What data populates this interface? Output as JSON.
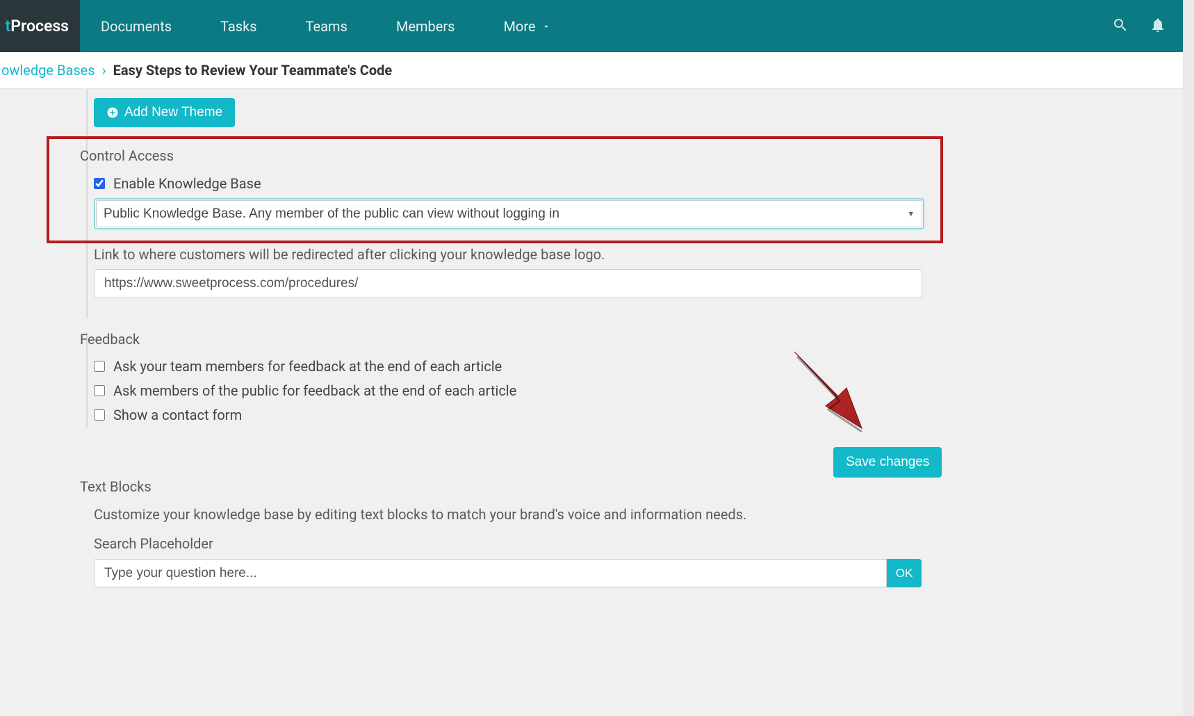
{
  "logo": {
    "t": "t",
    "process": "Process"
  },
  "nav": {
    "documents": "Documents",
    "tasks": "Tasks",
    "teams": "Teams",
    "members": "Members",
    "more": "More"
  },
  "breadcrumb": {
    "link": "owledge Bases",
    "sep": "›",
    "current": "Easy Steps to Review Your Teammate's Code"
  },
  "add_theme_btn": "Add New Theme",
  "control_access": {
    "heading": "Control Access",
    "enable_label": "Enable Knowledge Base",
    "select_value": "Public Knowledge Base. Any member of the public can view without logging in",
    "redirect_label": "Link to where customers will be redirected after clicking your knowledge base logo.",
    "redirect_value": "https://www.sweetprocess.com/procedures/"
  },
  "feedback": {
    "heading": "Feedback",
    "opt1": "Ask your team members for feedback at the end of each article",
    "opt2": "Ask members of the public for feedback at the end of each article",
    "opt3": "Show a contact form"
  },
  "save_btn": "Save changes",
  "text_blocks": {
    "heading": "Text Blocks",
    "desc": "Customize your knowledge base by editing text blocks to match your brand's voice and information needs.",
    "search_label": "Search Placeholder",
    "search_value": "Type your question here...",
    "ok": "OK"
  }
}
